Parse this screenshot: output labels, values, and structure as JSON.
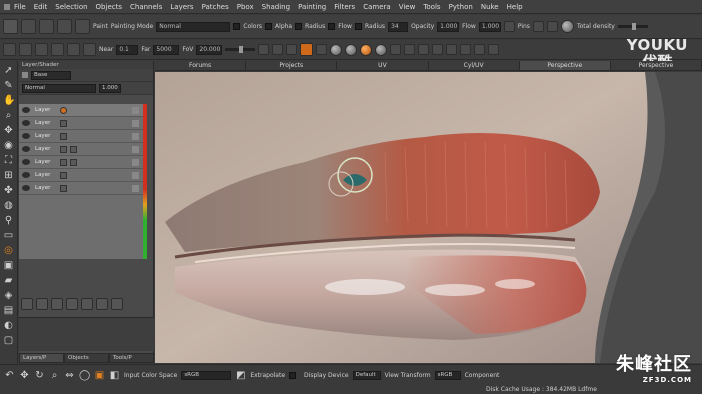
{
  "menu": [
    "File",
    "Edit",
    "Selection",
    "Objects",
    "Channels",
    "Layers",
    "Patches",
    "Pbox",
    "Shading",
    "Painting",
    "Filters",
    "Camera",
    "View",
    "Tools",
    "Python",
    "Nuke",
    "Help"
  ],
  "toolbar1": {
    "paint_label": "Paint",
    "painting_mode_label": "Painting Mode",
    "painting_mode_value": "Normal",
    "colors_label": "Colors",
    "alpha_label": "Alpha",
    "radius_label": "Radius",
    "flow_label": "Flow",
    "radius2_label": "Radius",
    "radius2_value": "34",
    "opacity_label": "Opacity",
    "opacity_value": "1.000",
    "flow2_label": "Flow",
    "flow2_value": "1.000",
    "pins_label": "Pins",
    "total_density_label": "Total density"
  },
  "toolbar2": {
    "near_label": "Near",
    "near_value": "0.1",
    "far_label": "Far",
    "far_value": "5000",
    "fov_label": "FoV",
    "fov_value": "20.000"
  },
  "logo": {
    "line1": "YOUKU",
    "line2": "优酷"
  },
  "layer_panel": {
    "title": "Layer/Shader",
    "shader_value": "Base",
    "blend_mode": "Normal",
    "blend_value": "1.000",
    "layers": [
      "Layer",
      "Layer",
      "Layer",
      "Layer",
      "Layer",
      "Layer",
      "Layer"
    ],
    "bottom_tabs": [
      "Layers/P",
      "Objects",
      "Tools/P"
    ]
  },
  "view_tabs": [
    "Forums",
    "Projects",
    "UV",
    "Cyl/UV",
    "Perspective",
    "Perspective"
  ],
  "status": {
    "input_color_space_label": "Input Color Space",
    "input_color_space_value": "sRGB",
    "extrapolate_label": "Extrapolate",
    "display_device_label": "Display Device",
    "display_device_value": "Default",
    "view_transform_label": "View Transform",
    "view_transform_value": "sRGB",
    "component_label": "Component",
    "disk_cache": "Disk Cache Usage : 384.42MB   Ldfme"
  },
  "watermark": {
    "line1": "朱峰社区",
    "line2": "ZF3D.COM"
  }
}
